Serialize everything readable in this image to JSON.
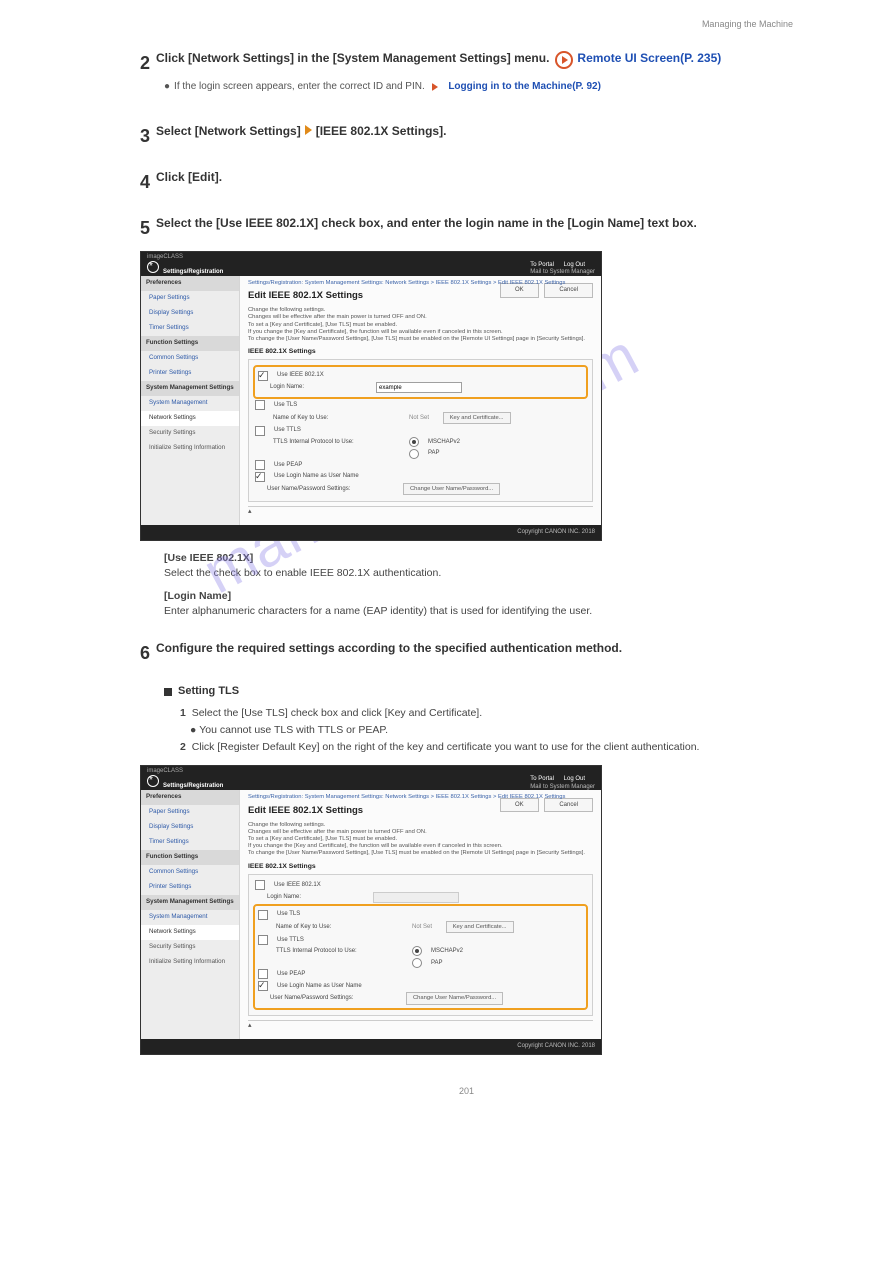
{
  "page_header_right": "Managing the Machine",
  "watermark": "manualshive.com",
  "step2": {
    "num": "2",
    "text": "Click [Network Settings] in the [System Management Settings] menu.",
    "icon_desc": "play-icon",
    "ref": "Remote UI Screen(P. 235)"
  },
  "note_line": "If the login screen appears, enter the correct ID and PIN.",
  "note_link": "Logging in to the Machine(P. 92)",
  "step3": {
    "num": "3",
    "text": "Select [Network Settings]",
    "arrow": "►",
    "tail": "[IEEE 802.1X Settings]."
  },
  "step4": {
    "num": "4",
    "text": "Click [Edit]."
  },
  "step5": {
    "num": "5",
    "text": "Select the [Use IEEE 802.1X] check box, and enter the login name in the [Login Name] text box."
  },
  "desc5a_label": "[Use IEEE 802.1X]",
  "desc5a": "Select the check box to enable IEEE 802.1X authentication.",
  "desc5b_label": "[Login Name]",
  "desc5b": "Enter alphanumeric characters for a name (EAP identity) that is used for identifying the user.",
  "step6": {
    "num": "6",
    "text": "Configure the required settings according to the specified authentication method."
  },
  "sub_title": "Setting TLS",
  "sub_steps": [
    "Select the [Use TLS] check box and click [Key and Certificate].",
    "You cannot use TLS with TTLS or PEAP.",
    "Click [Register Default Key] on the right of the key and certificate you want to use for the client authentication."
  ],
  "screenshot": {
    "model_bar": {
      "left": "imageCLASS",
      "right": ""
    },
    "topbar": {
      "title": "Settings/Registration",
      "portal": "To Portal",
      "logout": "Log Out",
      "mail": "Mail to System Manager"
    },
    "side": {
      "groups": [
        {
          "head": "Preferences",
          "items": [
            "Paper Settings",
            "Display Settings",
            "Timer Settings"
          ]
        },
        {
          "head": "Function Settings",
          "items": [
            "Common Settings",
            "Printer Settings"
          ]
        },
        {
          "head": "System Management Settings",
          "items": [
            "System Management",
            "Network Settings",
            "Security Settings",
            "Initialize Setting Information"
          ]
        }
      ],
      "selected": "Network Settings"
    },
    "crumb": "Settings/Registration: System Management Settings: Network Settings > IEEE 802.1X Settings > Edit IEEE 802.1X Settings",
    "title": "Edit IEEE 802.1X Settings",
    "buttons": {
      "ok": "OK",
      "cancel": "Cancel"
    },
    "info_lines": [
      "Change the following settings.",
      "Changes will be effective after the main power is turned OFF and ON.",
      "To set a [Key and Certificate], [Use TLS] must be enabled.",
      "If you change the [Key and Certificate], the function will be available even if canceled in this screen.",
      "To change the [User Name/Password Settings], [Use TLS] must be enabled on the [Remote UI Settings] page in [Security Settings]."
    ],
    "section": "IEEE 802.1X Settings",
    "fields": {
      "use8021x": "Use IEEE 802.1X",
      "login_name": "Login Name:",
      "login_val": "example",
      "use_tls": "Use TLS",
      "key_name": "Name of Key to Use:",
      "not_set": "Not Set",
      "key_btn": "Key and Certificate...",
      "use_ttls": "Use TTLS",
      "ttls_proto": "TTLS Internal Protocol to Use:",
      "proto1": "MSCHAPv2",
      "proto2": "PAP",
      "use_peap": "Use PEAP",
      "use_login_as_user": "Use Login Name as User Name",
      "unp": "User Name/Password Settings:",
      "unp_btn": "Change User Name/Password..."
    },
    "copyright": "Copyright CANON INC. 2018"
  },
  "page_num": "201"
}
